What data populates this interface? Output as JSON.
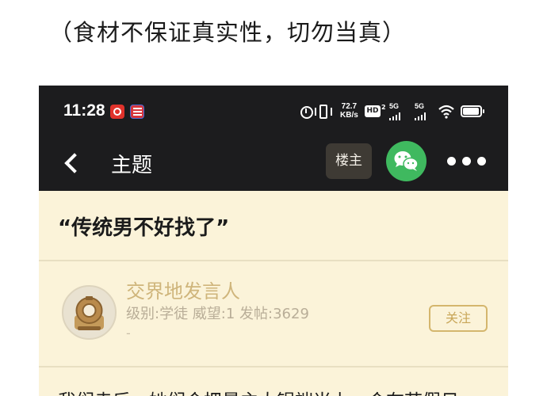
{
  "caption": "（食材不保证真实性，切勿当真）",
  "status_bar": {
    "time": "11:28",
    "net_speed_value": "72.7",
    "net_speed_unit": "KB/s",
    "hd_label": "HD",
    "hd_sub": "2",
    "signal1": "5G",
    "signal2": "5G"
  },
  "nav": {
    "title": "主题",
    "owner_label": "楼主"
  },
  "thread": {
    "title": "“传统男不好找了”"
  },
  "author": {
    "name": "交界地发言人",
    "meta": "级别:学徒 威望:1 发帖:3629",
    "dash": "-",
    "follow_label": "关注"
  },
  "post": {
    "text": "我们走后，她们会把最主大锅端当上，会在节假日"
  },
  "colors": {
    "dark_bar": "#1c1c1e",
    "cream_bg": "#fbf3d9",
    "wechat_green": "#3fb95f",
    "gold_text": "#cfb57b"
  }
}
